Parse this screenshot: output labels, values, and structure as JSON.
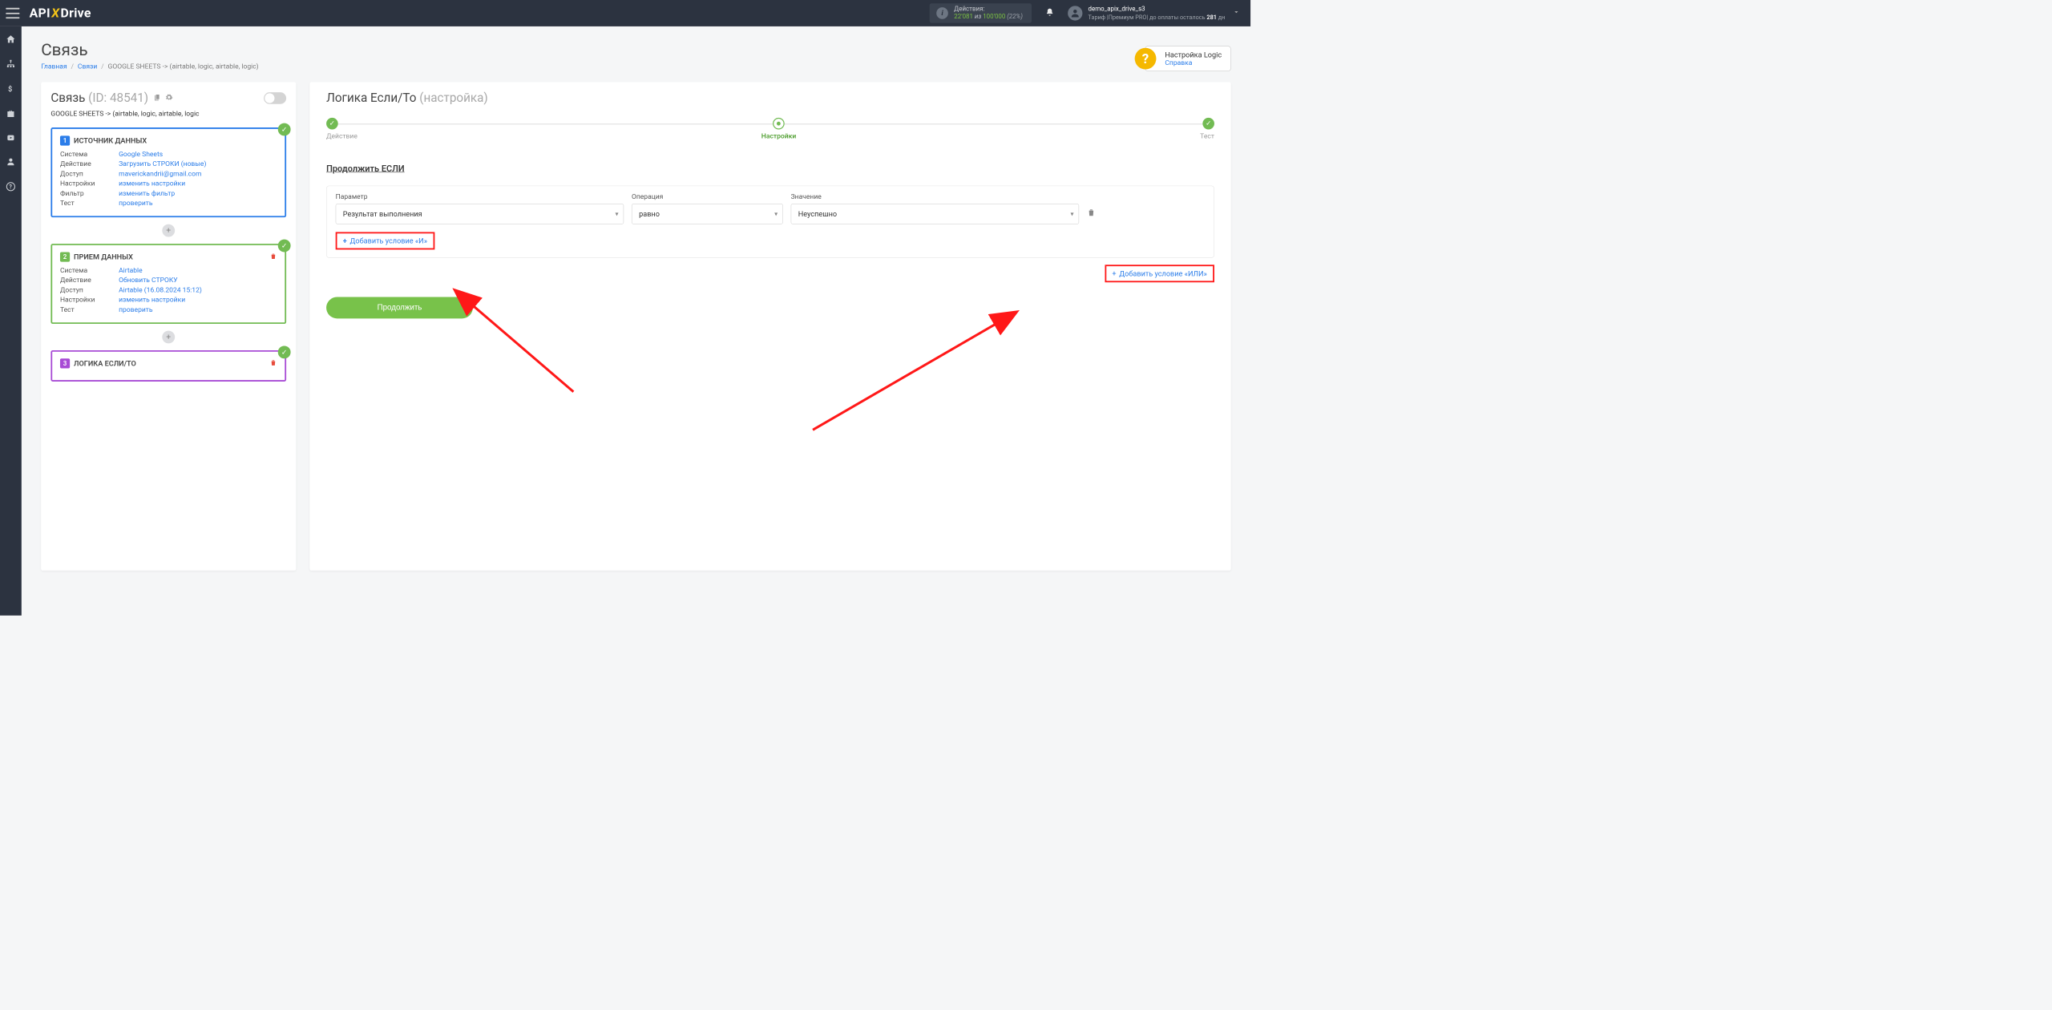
{
  "header": {
    "actions_label": "Действия:",
    "actions_current": "22'081",
    "actions_of": "из",
    "actions_max": "100'000",
    "actions_pct": "(22%)",
    "user_name": "demo_apix_drive_s3",
    "tariff_prefix": "Тариф |Премиум PRO| до оплаты осталось ",
    "tariff_days": "281",
    "tariff_suffix": " дн"
  },
  "page": {
    "title": "Связь",
    "crumb_home": "Главная",
    "crumb_links": "Связи",
    "crumb_current": "GOOGLE SHEETS -> (airtable, logic, airtable, logic)"
  },
  "help": {
    "title": "Настройка Logic",
    "link": "Справка"
  },
  "left": {
    "title": "Связь",
    "id_text": "(ID: 48541)",
    "subtitle": "GOOGLE SHEETS -> (airtable, logic, airtable, logic",
    "card1": {
      "title": "ИСТОЧНИК ДАННЫХ",
      "num": "1",
      "rows": {
        "system_k": "Система",
        "system_v": "Google Sheets",
        "action_k": "Действие",
        "action_v": "Загрузить СТРОКИ (новые)",
        "access_k": "Доступ",
        "access_v": "maverickandrii@gmail.com",
        "settings_k": "Настройки",
        "settings_v": "изменить настройки",
        "filter_k": "Фильтр",
        "filter_v": "изменить фильтр",
        "test_k": "Тест",
        "test_v": "проверить"
      }
    },
    "card2": {
      "title": "ПРИЕМ ДАННЫХ",
      "num": "2",
      "rows": {
        "system_k": "Система",
        "system_v": "Airtable",
        "action_k": "Действие",
        "action_v": "Обновить СТРОКУ",
        "access_k": "Доступ",
        "access_v": "Airtable (16.08.2024 15:12)",
        "settings_k": "Настройки",
        "settings_v": "изменить настройки",
        "test_k": "Тест",
        "test_v": "проверить"
      }
    },
    "card3": {
      "title": "ЛОГИКА ЕСЛИ/ТО",
      "num": "3"
    }
  },
  "right": {
    "title": "Логика Если/То",
    "title_paren": "(настройка)",
    "step1": "Действие",
    "step2": "Настройки",
    "step3": "Тест",
    "section": "Продолжить ЕСЛИ",
    "param_label": "Параметр",
    "param_value": "Результат выполнения",
    "op_label": "Операция",
    "op_value": "равно",
    "val_label": "Значение",
    "val_value": "Неуспешно",
    "add_and": "Добавить условие «И»",
    "add_or": "Добавить условие «ИЛИ»",
    "continue": "Продолжить"
  }
}
